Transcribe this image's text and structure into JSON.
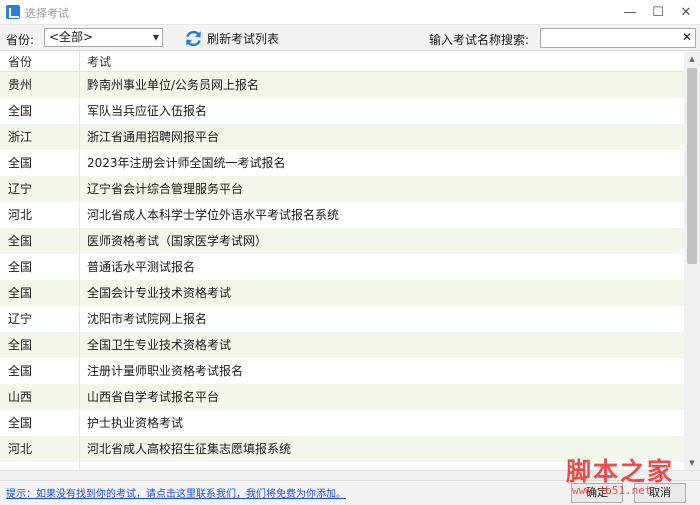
{
  "window": {
    "title": "选择考试",
    "controls": {
      "minimize": "—",
      "maximize": "☐",
      "close": "✕"
    }
  },
  "toolbar": {
    "province_label": "省份:",
    "province_selected": "<全部>",
    "refresh_label": "刷新考试列表",
    "search_label": "输入考试名称搜索:",
    "search_value": "",
    "search_placeholder": "",
    "search_clear": "✕"
  },
  "grid": {
    "columns": [
      "省份",
      "考试"
    ],
    "rows": [
      {
        "province": "贵州",
        "exam": "黔南州事业单位/公务员网上报名"
      },
      {
        "province": "全国",
        "exam": "军队当兵应征入伍报名"
      },
      {
        "province": "浙江",
        "exam": "浙江省通用招聘网报平台"
      },
      {
        "province": "全国",
        "exam": "2023年注册会计师全国统一考试报名"
      },
      {
        "province": "辽宁",
        "exam": "辽宁省会计综合管理服务平台"
      },
      {
        "province": "河北",
        "exam": "河北省成人本科学士学位外语水平考试报名系统"
      },
      {
        "province": "全国",
        "exam": "医师资格考试（国家医学考试网）"
      },
      {
        "province": "全国",
        "exam": "普通话水平测试报名"
      },
      {
        "province": "全国",
        "exam": "全国会计专业技术资格考试"
      },
      {
        "province": "辽宁",
        "exam": "沈阳市考试院网上报名"
      },
      {
        "province": "全国",
        "exam": "全国卫生专业技术资格考试"
      },
      {
        "province": "全国",
        "exam": "注册计量师职业资格考试报名"
      },
      {
        "province": "山西",
        "exam": "山西省自学考试报名平台"
      },
      {
        "province": "全国",
        "exam": "护士执业资格考试"
      },
      {
        "province": "河北",
        "exam": "河北省成人高校招生征集志愿填报系统"
      },
      {
        "province": "",
        "exam": ""
      }
    ]
  },
  "scrollbar": {
    "up": "▲",
    "down": "▼"
  },
  "footer": {
    "tip": "提示：如果没有找到你的考试，请点击这里联系我们，我们将免费为你添加。",
    "ok_label": "确定",
    "cancel_label": "取消"
  },
  "watermark": {
    "brand": "脚本之家",
    "url": "www.jb51.net"
  },
  "colors": {
    "row_alt": "#f1f7ea",
    "link": "#1a4fd6",
    "refresh_icon": "#1f7fe0",
    "watermark": "#e6302f"
  }
}
